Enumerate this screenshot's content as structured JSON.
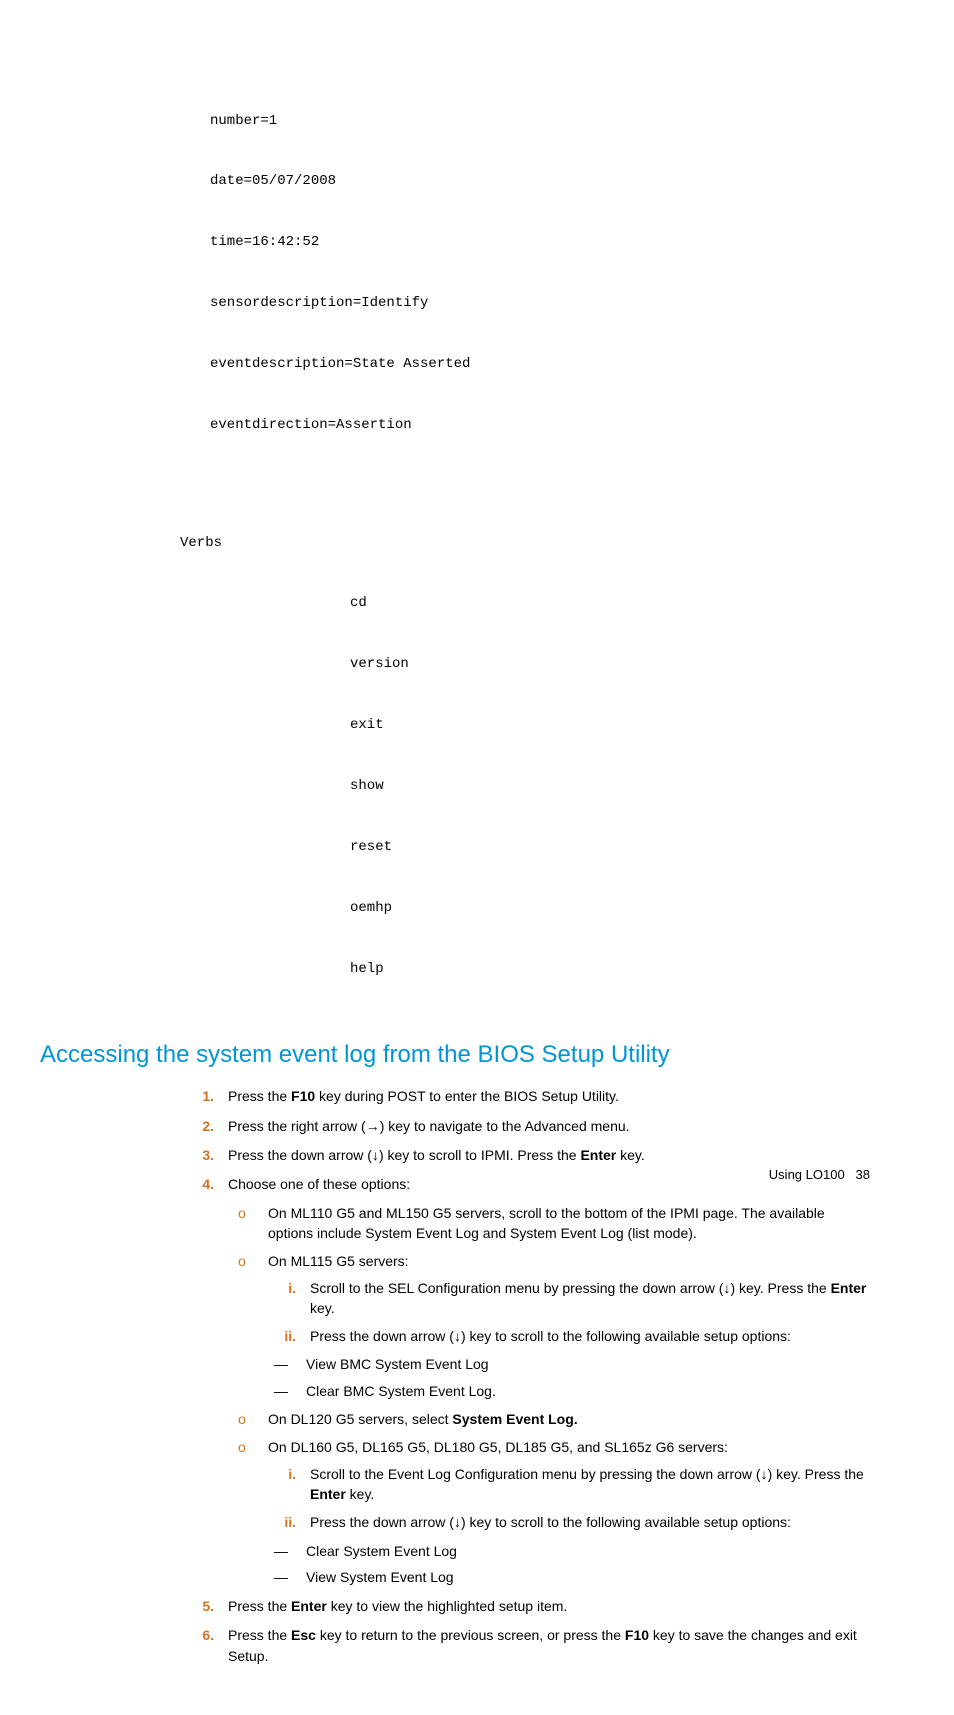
{
  "code1": {
    "l1": "number=1",
    "l2": "date=05/07/2008",
    "l3": "time=16:42:52",
    "l4": "sensordescription=Identify",
    "l5": "eventdescription=State Asserted",
    "l6": "eventdirection=Assertion"
  },
  "code2": {
    "verbs": "Verbs",
    "v1": "cd",
    "v2": "version",
    "v3": "exit",
    "v4": "show",
    "v5": "reset",
    "v6": "oemhp",
    "v7": "help"
  },
  "heading": "Accessing the system event log from the BIOS Setup Utility",
  "steps": {
    "m1": "1.",
    "s1a": "Press the ",
    "s1b": "F10",
    "s1c": " key during POST to enter the BIOS Setup Utility.",
    "m2": "2.",
    "s2": "Press the right arrow (→) key to navigate to the Advanced menu.",
    "m3": "3.",
    "s3a": "Press the down arrow (↓) key to scroll to IPMI. Press the ",
    "s3b": "Enter",
    "s3c": " key.",
    "m4": "4.",
    "s4": "Choose one of these options:",
    "m5": "5.",
    "s5a": "Press the ",
    "s5b": "Enter",
    "s5c": " key to view the highlighted setup item.",
    "m6": "6.",
    "s6a": "Press the ",
    "s6b": "Esc",
    "s6c": " key to return to the previous screen, or press the ",
    "s6d": "F10",
    "s6e": " key to save the changes and exit Setup."
  },
  "circ_marker": "o",
  "sub4": {
    "a": "On ML110 G5 and ML150 G5 servers, scroll to the bottom of the IPMI page. The available options include System Event Log and System Event Log (list mode).",
    "b": "On ML115 G5 servers:",
    "b_i_m": "i.",
    "b_i_a": "Scroll to the SEL Configuration menu by pressing the down arrow (↓) key. Press the ",
    "b_i_b": "Enter",
    "b_i_c": " key.",
    "b_ii_m": "ii.",
    "b_ii": "Press the down arrow (↓) key to scroll to the following available setup options:",
    "b_d1": "View BMC System Event Log",
    "b_d2": "Clear BMC System Event Log.",
    "c_a": "On DL120 G5 servers, select ",
    "c_b": "System Event Log.",
    "d": "On DL160 G5, DL165 G5, DL180 G5, DL185 G5, and SL165z G6 servers:",
    "d_i_m": "i.",
    "d_i_a": "Scroll to the Event Log Configuration menu by pressing the down arrow (↓) key. Press the ",
    "d_i_b": "Enter",
    "d_i_c": " key.",
    "d_ii_m": "ii.",
    "d_ii": "Press the down arrow (↓) key to scroll to the following available setup options:",
    "d_d1": "Clear System Event Log",
    "d_d2": "View System Event Log"
  },
  "dash_marker": "—",
  "footer": {
    "section": "Using LO100",
    "page": "38"
  }
}
